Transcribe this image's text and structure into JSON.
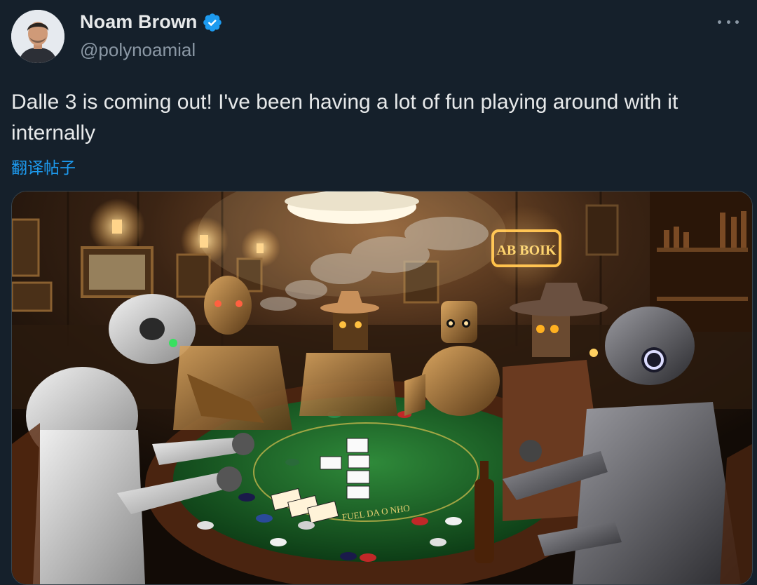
{
  "author": {
    "display_name": "Noam Brown",
    "handle": "@polynoamial",
    "verified": true,
    "avatar_icon": "person-avatar"
  },
  "tweet": {
    "text": "Dalle 3 is coming out! I've been having a lot of fun playing around with it internally",
    "translate_label": "翻译帖子"
  },
  "media": {
    "sign_text": "AB BOIK",
    "felt_text": "FUEL DA O NHO"
  },
  "icons": {
    "more": "more-horizontal-icon",
    "verified": "verified-badge-icon"
  },
  "colors": {
    "background": "#15202b",
    "text": "#e7e9ea",
    "secondary": "#8b98a5",
    "accent": "#1d9bf0"
  }
}
